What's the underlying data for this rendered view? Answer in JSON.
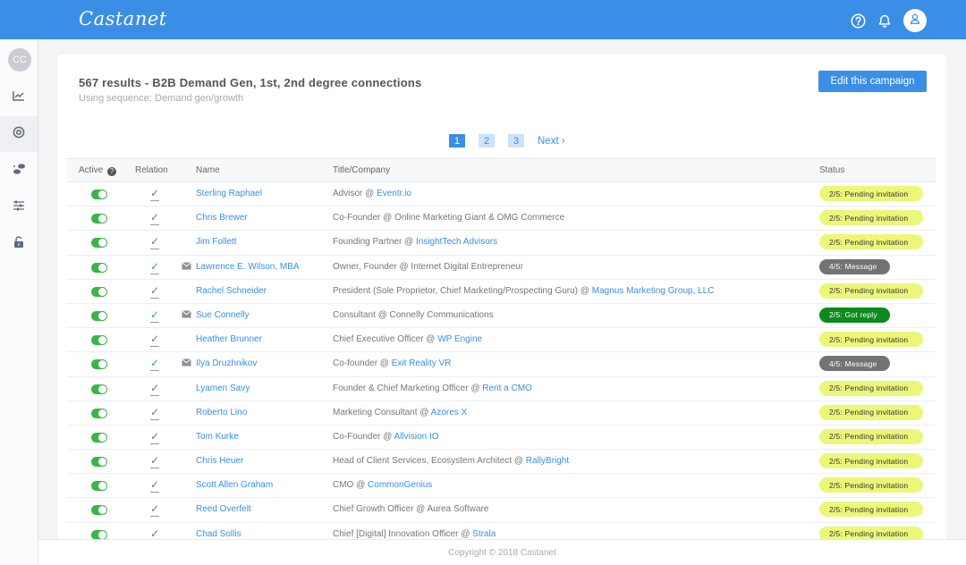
{
  "app": {
    "brand": "Castanet",
    "avatar_initials": "CC"
  },
  "colors": {
    "accent": "#3a8ee6",
    "toggle_on": "#3bb54a",
    "pending": "#ecf779",
    "message": "#737373",
    "reply": "#0c8a1c"
  },
  "header_icons": [
    "help-circle-icon",
    "bell-icon",
    "user-icon"
  ],
  "sidebar": {
    "items": [
      "chart-icon",
      "target-icon",
      "footprints-icon",
      "sliders-icon",
      "unlock-icon"
    ]
  },
  "campaign": {
    "title": "567 results - B2B Demand Gen, 1st, 2nd degree connections",
    "subtitle": "Using sequence: Demand gen/growth",
    "edit_label": "Edit this campaign"
  },
  "pagination": {
    "pages": [
      "1",
      "2",
      "3"
    ],
    "current": "1",
    "next_label": "Next ›"
  },
  "table": {
    "headers": {
      "active": "Active",
      "relation": "Relation",
      "name": "Name",
      "title": "Title/Company",
      "status": "Status"
    },
    "rows": [
      {
        "name": "Sterling Raphael",
        "title": "Advisor @ ",
        "company": "Eventr.io",
        "status": "2/5: Pending invitation",
        "status_kind": "pending",
        "mail": false,
        "green": false
      },
      {
        "name": "Chris Brewer",
        "title": "Co-Founder @ Online Marketing Giant & OMG Commerce",
        "company": "",
        "status": "2/5: Pending invitation",
        "status_kind": "pending",
        "mail": false,
        "green": false
      },
      {
        "name": "Jim Follett",
        "title": "Founding Partner @ ",
        "company": "InsightTech Advisors",
        "status": "2/5: Pending invitation",
        "status_kind": "pending",
        "mail": false,
        "green": false
      },
      {
        "name": "Lawrence E. Wilson, MBA",
        "title": "Owner, Founder @ Internet Digital Entrepreneur",
        "company": "",
        "status": "4/5: Message",
        "status_kind": "message",
        "mail": true,
        "green": true
      },
      {
        "name": "Rachel Schneider",
        "title": "President (Sole Proprietor, Chief Marketing/Prospecting Guru) @ ",
        "company": "Magnus Marketing Group, LLC",
        "status": "2/5: Pending invitation",
        "status_kind": "pending",
        "mail": false,
        "green": false
      },
      {
        "name": "Sue Connelly",
        "title": "Consultant @ Connelly Communications",
        "company": "",
        "status": "2/5: Got reply",
        "status_kind": "reply",
        "mail": true,
        "green": true
      },
      {
        "name": "Heather Brunner",
        "title": "Chief Executive Officer @ ",
        "company": "WP Engine",
        "status": "2/5: Pending invitation",
        "status_kind": "pending",
        "mail": false,
        "green": false
      },
      {
        "name": "Ilya Druzhnikov",
        "title": "Co-founder @ ",
        "company": "Exit Reality VR",
        "status": "4/5: Message",
        "status_kind": "message",
        "mail": true,
        "green": true
      },
      {
        "name": "Lyamen Savy",
        "title": "Founder & Chief Marketing Officer @ ",
        "company": "Rent a CMO",
        "status": "2/5: Pending invitation",
        "status_kind": "pending",
        "mail": false,
        "green": false
      },
      {
        "name": "Roberto Lino",
        "title": "Marketing Consultant @ ",
        "company": "Azores X",
        "status": "2/5: Pending invitation",
        "status_kind": "pending",
        "mail": false,
        "green": false
      },
      {
        "name": "Tom Kurke",
        "title": "Co-Founder @ ",
        "company": "Allvision IO",
        "status": "2/5: Pending invitation",
        "status_kind": "pending",
        "mail": false,
        "green": false
      },
      {
        "name": "Chris Heuer",
        "title": "Head of Client Services, Ecosystem Architect @ ",
        "company": "RallyBright",
        "status": "2/5: Pending invitation",
        "status_kind": "pending",
        "mail": false,
        "green": false
      },
      {
        "name": "Scott Allen Graham",
        "title": "CMO @ ",
        "company": "CommonGenius",
        "status": "2/5: Pending invitation",
        "status_kind": "pending",
        "mail": false,
        "green": false
      },
      {
        "name": "Reed Overfelt",
        "title": "Chief Growth Officer @ Aurea Software",
        "company": "",
        "status": "2/5: Pending invitation",
        "status_kind": "pending",
        "mail": false,
        "green": false
      },
      {
        "name": "Chad Sollis",
        "title": "Chief [Digital] Innovation Officer @ ",
        "company": "Strala",
        "status": "2/5: Pending invitation",
        "status_kind": "pending",
        "mail": false,
        "green": false
      }
    ]
  },
  "footer": {
    "copyright": "Copyright © 2018 Castanet"
  }
}
